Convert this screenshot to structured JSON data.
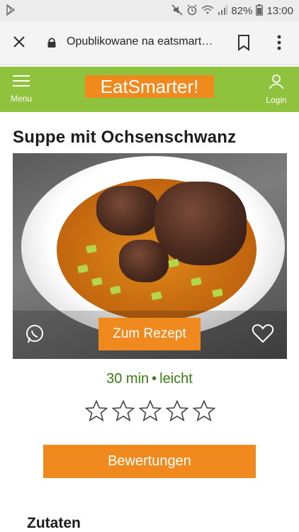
{
  "status_bar": {
    "battery_percent": "82%",
    "time": "13:00",
    "icons": [
      "play-store-icon",
      "mute-icon",
      "alarm-icon",
      "wifi-icon",
      "signal-icon",
      "battery-icon"
    ]
  },
  "browser": {
    "url_text": "Opublikowane na eatsmart…",
    "icons": [
      "close-icon",
      "lock-icon",
      "bookmark-icon",
      "more-vert-icon"
    ]
  },
  "site_header": {
    "menu_label": "Menu",
    "logo_text": "EatSmarter!",
    "login_label": "Login",
    "colors": {
      "header_bg": "#8fc33e",
      "accent": "#f08a1e"
    }
  },
  "recipe": {
    "title": "Suppe mit Ochsenschwanz",
    "cta_label": "Zum Rezept",
    "duration": "30 min",
    "difficulty": "leicht",
    "separator": "•",
    "rating": {
      "stars_filled": 0,
      "stars_total": 5
    },
    "ratings_button": "Bewertungen",
    "ingredients_heading": "Zutaten"
  }
}
